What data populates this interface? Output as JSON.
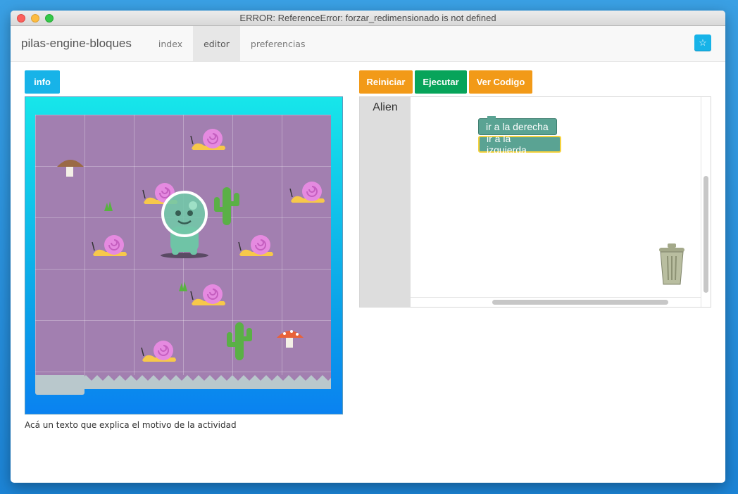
{
  "window": {
    "title": "ERROR: ReferenceError: forzar_redimensionado is not defined"
  },
  "navbar": {
    "brand": "pilas-engine-bloques",
    "tabs": [
      {
        "label": "index",
        "active": false
      },
      {
        "label": "editor",
        "active": true
      },
      {
        "label": "preferencias",
        "active": false
      }
    ],
    "star_icon": "star-icon"
  },
  "toolbar": {
    "info_label": "info",
    "reiniciar_label": "Reiniciar",
    "ejecutar_label": "Ejecutar",
    "ver_codigo_label": "Ver Codigo"
  },
  "game": {
    "caption": "Acá un texto que explica el motivo de la actividad"
  },
  "editor": {
    "category": "Alien",
    "blocks": [
      "ir a la derecha",
      "ir a la izquierda"
    ]
  },
  "colors": {
    "info": "#17b3e8",
    "reiniciar": "#f29a18",
    "ejecutar": "#07a45a",
    "block": "#5aa393",
    "block_selected_border": "#f5d23d",
    "board": "#a27fb0"
  }
}
